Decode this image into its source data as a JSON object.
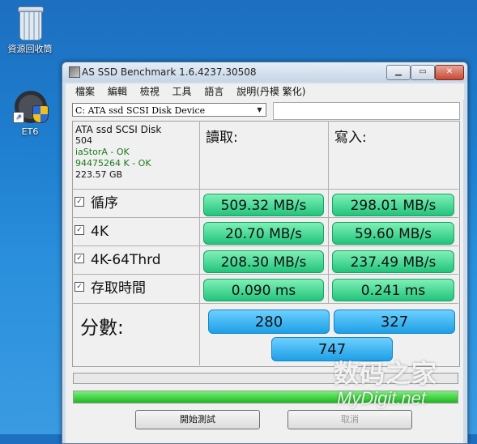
{
  "desktop": {
    "icons": [
      {
        "label": "資源回收筒",
        "icon": "recycle-bin-icon"
      },
      {
        "label": "ET6",
        "icon": "steering-wheel-icon"
      }
    ]
  },
  "window": {
    "title": "AS SSD Benchmark 1.6.4237.30508",
    "controls": {
      "minimize": "▁",
      "maximize": "▭",
      "close": "✕"
    }
  },
  "menu": [
    "檔案",
    "編輯",
    "檢視",
    "工具",
    "語言",
    "說明(丹模 繁化)"
  ],
  "drive": {
    "selected": "C: ATA ssd SCSI Disk Device"
  },
  "device_info": {
    "name": "ATA ssd SCSI Disk",
    "firmware": "504",
    "driver": "iaStorA - OK",
    "alignment": "94475264 K - OK",
    "size": "223.57 GB"
  },
  "columns": {
    "read": "讀取:",
    "write": "寫入:"
  },
  "tests": [
    {
      "label": "循序",
      "checked": true,
      "read": "509.32 MB/s",
      "write": "298.01 MB/s"
    },
    {
      "label": "4K",
      "checked": true,
      "read": "20.70 MB/s",
      "write": "59.60 MB/s"
    },
    {
      "label": "4K-64Thrd",
      "checked": true,
      "read": "208.30 MB/s",
      "write": "237.49 MB/s"
    },
    {
      "label": "存取時間",
      "checked": true,
      "read": "0.090 ms",
      "write": "0.241 ms"
    }
  ],
  "score": {
    "label": "分數:",
    "read": "280",
    "write": "327",
    "total": "747"
  },
  "progress": {
    "bar1": 0,
    "bar2": 1.0
  },
  "buttons": {
    "start": "開始測試",
    "abort": "取消"
  },
  "watermark": {
    "cn": "数码之家",
    "en": "MyDigit.net"
  },
  "colors": {
    "result_green": "#22c47c",
    "score_blue": "#1e9fe6",
    "progress_green": "#1fb81f"
  }
}
